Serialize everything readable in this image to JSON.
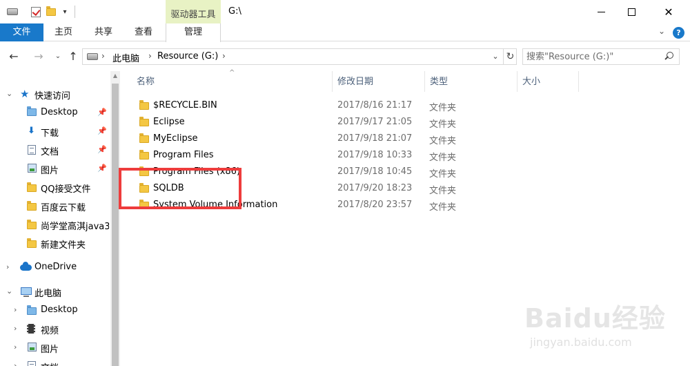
{
  "window": {
    "title": "G:\\",
    "context_tab": "驱动器工具"
  },
  "ribbon": {
    "tabs": [
      "文件",
      "主页",
      "共享",
      "查看",
      "管理"
    ]
  },
  "address": {
    "crumbs": [
      "此电脑",
      "Resource (G:)"
    ],
    "search_placeholder": "搜索\"Resource (G:)\""
  },
  "navigation": {
    "items": [
      {
        "label": "快速访问",
        "icon": "star-icon"
      },
      {
        "label": "Desktop",
        "icon": "desktop-folder-icon",
        "pinned": true
      },
      {
        "label": "下载",
        "icon": "download-icon",
        "pinned": true
      },
      {
        "label": "文档",
        "icon": "document-icon",
        "pinned": true
      },
      {
        "label": "图片",
        "icon": "picture-icon",
        "pinned": true
      },
      {
        "label": "QQ接受文件",
        "icon": "folder-icon"
      },
      {
        "label": "百度云下载",
        "icon": "folder-icon"
      },
      {
        "label": "尚学堂高淇java3",
        "icon": "folder-icon"
      },
      {
        "label": "新建文件夹",
        "icon": "folder-icon"
      },
      {
        "label": "OneDrive",
        "icon": "onedrive-icon"
      },
      {
        "label": "此电脑",
        "icon": "this-pc-icon"
      },
      {
        "label": "Desktop",
        "icon": "desktop-folder-icon"
      },
      {
        "label": "视频",
        "icon": "video-icon"
      },
      {
        "label": "图片",
        "icon": "picture-icon"
      },
      {
        "label": "文档",
        "icon": "document-icon"
      }
    ]
  },
  "columns": [
    "名称",
    "修改日期",
    "类型",
    "大小"
  ],
  "files": [
    {
      "name": "$RECYCLE.BIN",
      "date": "2017/8/16 21:17",
      "type": "文件夹"
    },
    {
      "name": "Eclipse",
      "date": "2017/9/17 21:05",
      "type": "文件夹"
    },
    {
      "name": "MyEclipse",
      "date": "2017/9/18 21:07",
      "type": "文件夹"
    },
    {
      "name": "Program Files",
      "date": "2017/9/18 10:33",
      "type": "文件夹"
    },
    {
      "name": "Program Files (x86)",
      "date": "2017/9/18 10:45",
      "type": "文件夹"
    },
    {
      "name": "SQLDB",
      "date": "2017/9/20 18:23",
      "type": "文件夹"
    },
    {
      "name": "System Volume Information",
      "date": "2017/8/20 23:57",
      "type": "文件夹"
    }
  ],
  "highlighted_file": "SQLDB",
  "watermark": {
    "brand": "Baidu经验",
    "url": "jingyan.baidu.com"
  },
  "colors": {
    "file_tab": "#1979ca",
    "context_tab_bg": "#e8f2c4",
    "highlight": "#ee3c3c",
    "folder": "#f4c743"
  }
}
